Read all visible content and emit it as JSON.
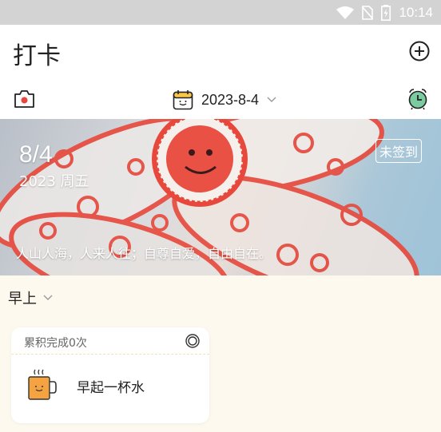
{
  "status_bar": {
    "time": "10:14",
    "icons": [
      "wifi-icon",
      "no-sim-icon",
      "battery-icon"
    ]
  },
  "header": {
    "title": "打卡",
    "add_icon": "add-circle-icon"
  },
  "toolbar": {
    "camera_icon": "camera-icon",
    "date": "2023-8-4",
    "calendar_icon": "calendar-icon",
    "alarm_icon": "alarm-clock-icon"
  },
  "banner": {
    "day": "8/4",
    "year_weekday": "2023 周五",
    "status_badge": "未签到",
    "quote": "人山人海，人来人往；自尊自爱，自由自在。"
  },
  "section": {
    "label": "早上"
  },
  "habit_card": {
    "count_text": "累积完成0次",
    "habit_name": "早起一杯水",
    "icon": "coffee-cup-icon",
    "target_icon": "target-icon"
  },
  "colors": {
    "accent_red": "#e8483b",
    "card_bg": "#ffffff",
    "page_bg": "#fdf9ef",
    "cup_orange": "#f4a340"
  }
}
